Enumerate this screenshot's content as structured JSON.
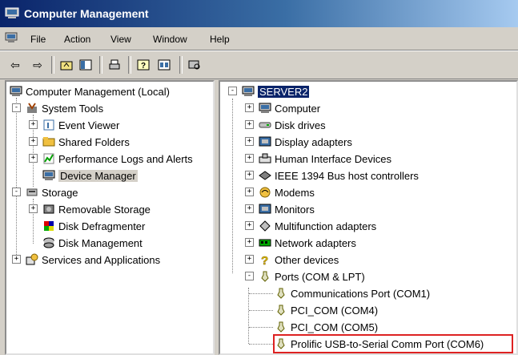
{
  "window": {
    "title": "Computer Management"
  },
  "menu": {
    "items": [
      "File",
      "Action",
      "View",
      "Window",
      "Help"
    ]
  },
  "left_tree": [
    {
      "label": "Computer Management (Local)",
      "level": 0,
      "expander": "none",
      "icon": "computer-icon"
    },
    {
      "label": "System Tools",
      "level": 1,
      "expander": "-",
      "icon": "tools-icon"
    },
    {
      "label": "Event Viewer",
      "level": 2,
      "expander": "+",
      "icon": "event-viewer-icon"
    },
    {
      "label": "Shared Folders",
      "level": 2,
      "expander": "+",
      "icon": "shared-folders-icon"
    },
    {
      "label": "Performance Logs and Alerts",
      "level": 2,
      "expander": "+",
      "icon": "performance-icon"
    },
    {
      "label": "Device Manager",
      "level": 2,
      "expander": "none",
      "icon": "device-manager-icon",
      "selected": true
    },
    {
      "label": "Storage",
      "level": 1,
      "expander": "-",
      "icon": "storage-icon"
    },
    {
      "label": "Removable Storage",
      "level": 2,
      "expander": "+",
      "icon": "removable-storage-icon"
    },
    {
      "label": "Disk Defragmenter",
      "level": 2,
      "expander": "none",
      "icon": "defragmenter-icon"
    },
    {
      "label": "Disk Management",
      "level": 2,
      "expander": "none",
      "icon": "disk-management-icon"
    },
    {
      "label": "Services and Applications",
      "level": 1,
      "expander": "+",
      "icon": "services-icon"
    }
  ],
  "right_tree": [
    {
      "label": "SERVER2",
      "level": 0,
      "expander": "-",
      "icon": "computer-icon",
      "selected": true
    },
    {
      "label": "Computer",
      "level": 1,
      "expander": "+",
      "icon": "computer-icon"
    },
    {
      "label": "Disk drives",
      "level": 1,
      "expander": "+",
      "icon": "disk-drive-icon"
    },
    {
      "label": "Display adapters",
      "level": 1,
      "expander": "+",
      "icon": "display-adapter-icon"
    },
    {
      "label": "Human Interface Devices",
      "level": 1,
      "expander": "+",
      "icon": "hid-icon"
    },
    {
      "label": "IEEE 1394 Bus host controllers",
      "level": 1,
      "expander": "+",
      "icon": "ieee1394-icon"
    },
    {
      "label": "Modems",
      "level": 1,
      "expander": "+",
      "icon": "modem-icon"
    },
    {
      "label": "Monitors",
      "level": 1,
      "expander": "+",
      "icon": "monitor-icon"
    },
    {
      "label": "Multifunction adapters",
      "level": 1,
      "expander": "+",
      "icon": "multifunction-icon"
    },
    {
      "label": "Network adapters",
      "level": 1,
      "expander": "+",
      "icon": "network-adapter-icon"
    },
    {
      "label": "Other devices",
      "level": 1,
      "expander": "+",
      "icon": "other-devices-icon"
    },
    {
      "label": "Ports (COM & LPT)",
      "level": 1,
      "expander": "-",
      "icon": "port-icon"
    },
    {
      "label": "Communications Port (COM1)",
      "level": 2,
      "expander": "none",
      "icon": "port-icon"
    },
    {
      "label": "PCI_COM (COM4)",
      "level": 2,
      "expander": "none",
      "icon": "port-icon"
    },
    {
      "label": "PCI_COM (COM5)",
      "level": 2,
      "expander": "none",
      "icon": "port-icon"
    },
    {
      "label": "Prolific USB-to-Serial Comm Port (COM6)",
      "level": 2,
      "expander": "none",
      "icon": "port-icon",
      "highlighted": true
    }
  ],
  "colors": {
    "title_start": "#0a246a",
    "title_end": "#a6caf0",
    "selection": "#0a246a",
    "highlight_box": "#dd2222"
  }
}
